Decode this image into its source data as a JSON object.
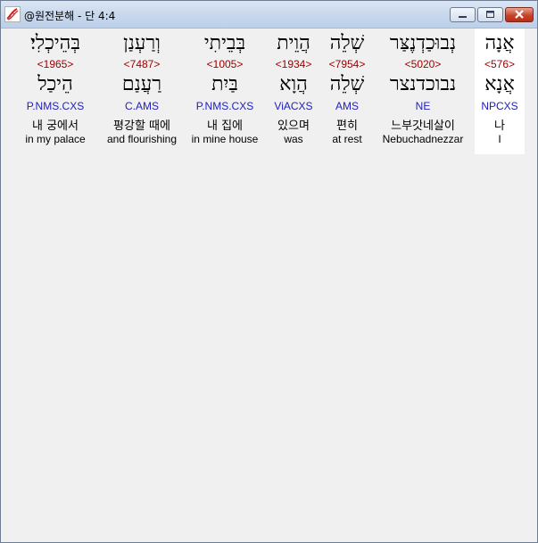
{
  "window": {
    "title": "@원전분해 - 단 4:4"
  },
  "words": [
    {
      "hebrew": "בְּהֵיכְלִי׃",
      "strong": "<1965>",
      "lemma": "הֵיכַל",
      "morph": "P.NMS.CXS",
      "korean": "내 궁에서",
      "english": "in my palace"
    },
    {
      "hebrew": "וְרַעְנַן",
      "strong": "<7487>",
      "lemma": "רַעֲנַם",
      "morph": "C.AMS",
      "korean": "평강할 때에",
      "english": "and flourishing"
    },
    {
      "hebrew": "בְּבֵיתִי",
      "strong": "<1005>",
      "lemma": "בַּיִת",
      "morph": "P.NMS.CXS",
      "korean": "내 집에",
      "english": "in mine house"
    },
    {
      "hebrew": "הֲוֵית",
      "strong": "<1934>",
      "lemma": "הֲוָא",
      "morph": "ViACXS",
      "korean": "있으며",
      "english": "was"
    },
    {
      "hebrew": "שְׁלֵה",
      "strong": "<7954>",
      "lemma": "שְׁלֵה",
      "morph": "AMS",
      "korean": "편히",
      "english": "at rest"
    },
    {
      "hebrew": "נְבוּכַדְנֶצַּר",
      "strong": "<5020>",
      "lemma": "נבוכדנצר",
      "morph": "NE",
      "korean": "느부갓네살이",
      "english": "Nebuchadnezzar"
    },
    {
      "hebrew": "אֲנָה",
      "strong": "<576>",
      "lemma": "אֲנָא",
      "morph": "NPCXS",
      "korean": "나",
      "english": "I"
    }
  ],
  "icons": {
    "app": "dna-icon",
    "minimize": "minimize-icon",
    "maximize": "maximize-icon",
    "close": "close-icon"
  }
}
